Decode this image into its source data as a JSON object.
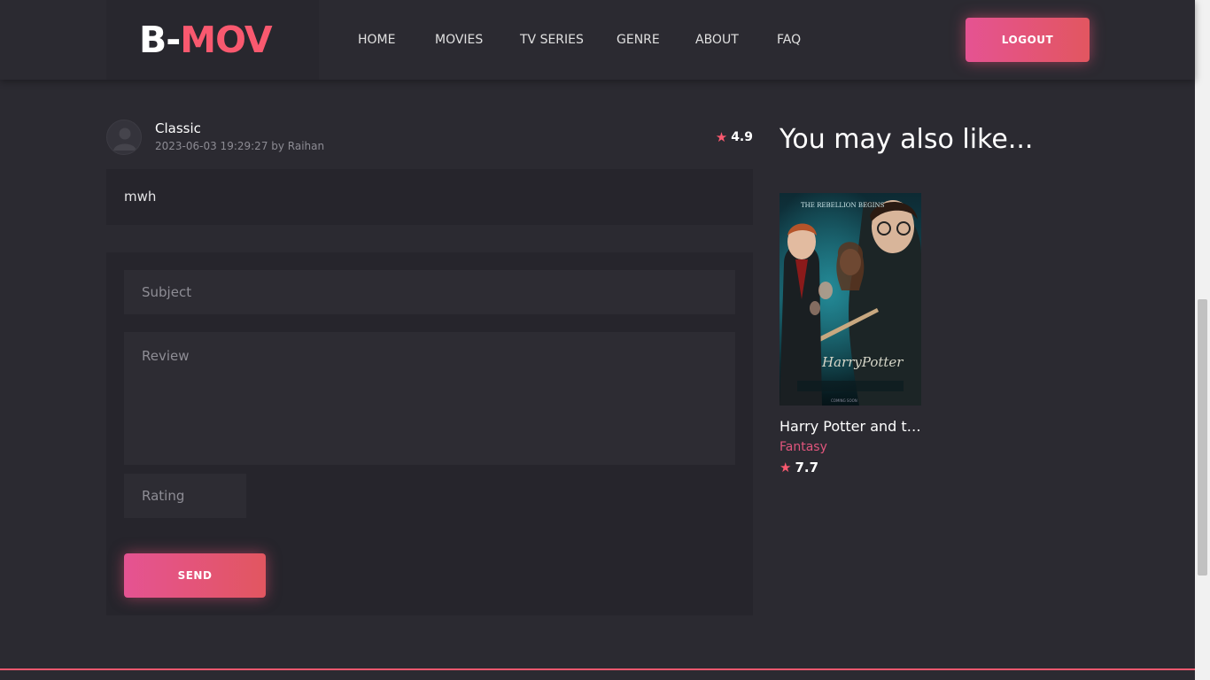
{
  "logo": {
    "part1": "B-",
    "part2": "MOV"
  },
  "nav": {
    "items": [
      {
        "label": "HOME"
      },
      {
        "label": "MOVIES"
      },
      {
        "label": "TV SERIES"
      },
      {
        "label": "GENRE"
      },
      {
        "label": "ABOUT"
      },
      {
        "label": "FAQ"
      }
    ],
    "logout_label": "LOGOUT"
  },
  "review": {
    "title": "Classic",
    "meta": "2023-06-03 19:29:27 by Raihan",
    "rating": "4.9",
    "body": "mwh"
  },
  "form": {
    "subject_placeholder": "Subject",
    "review_placeholder": "Review",
    "rating_placeholder": "Rating",
    "send_label": "SEND"
  },
  "sidebar": {
    "title": "You may also like...",
    "cards": [
      {
        "title": "Harry Potter and the Order of the Phoenix",
        "genre": "Fantasy",
        "rating": "7.7"
      }
    ]
  },
  "colors": {
    "accent": "#f9596f",
    "background": "#2b2a31",
    "panel": "#26252c",
    "genre": "#e0557c"
  }
}
